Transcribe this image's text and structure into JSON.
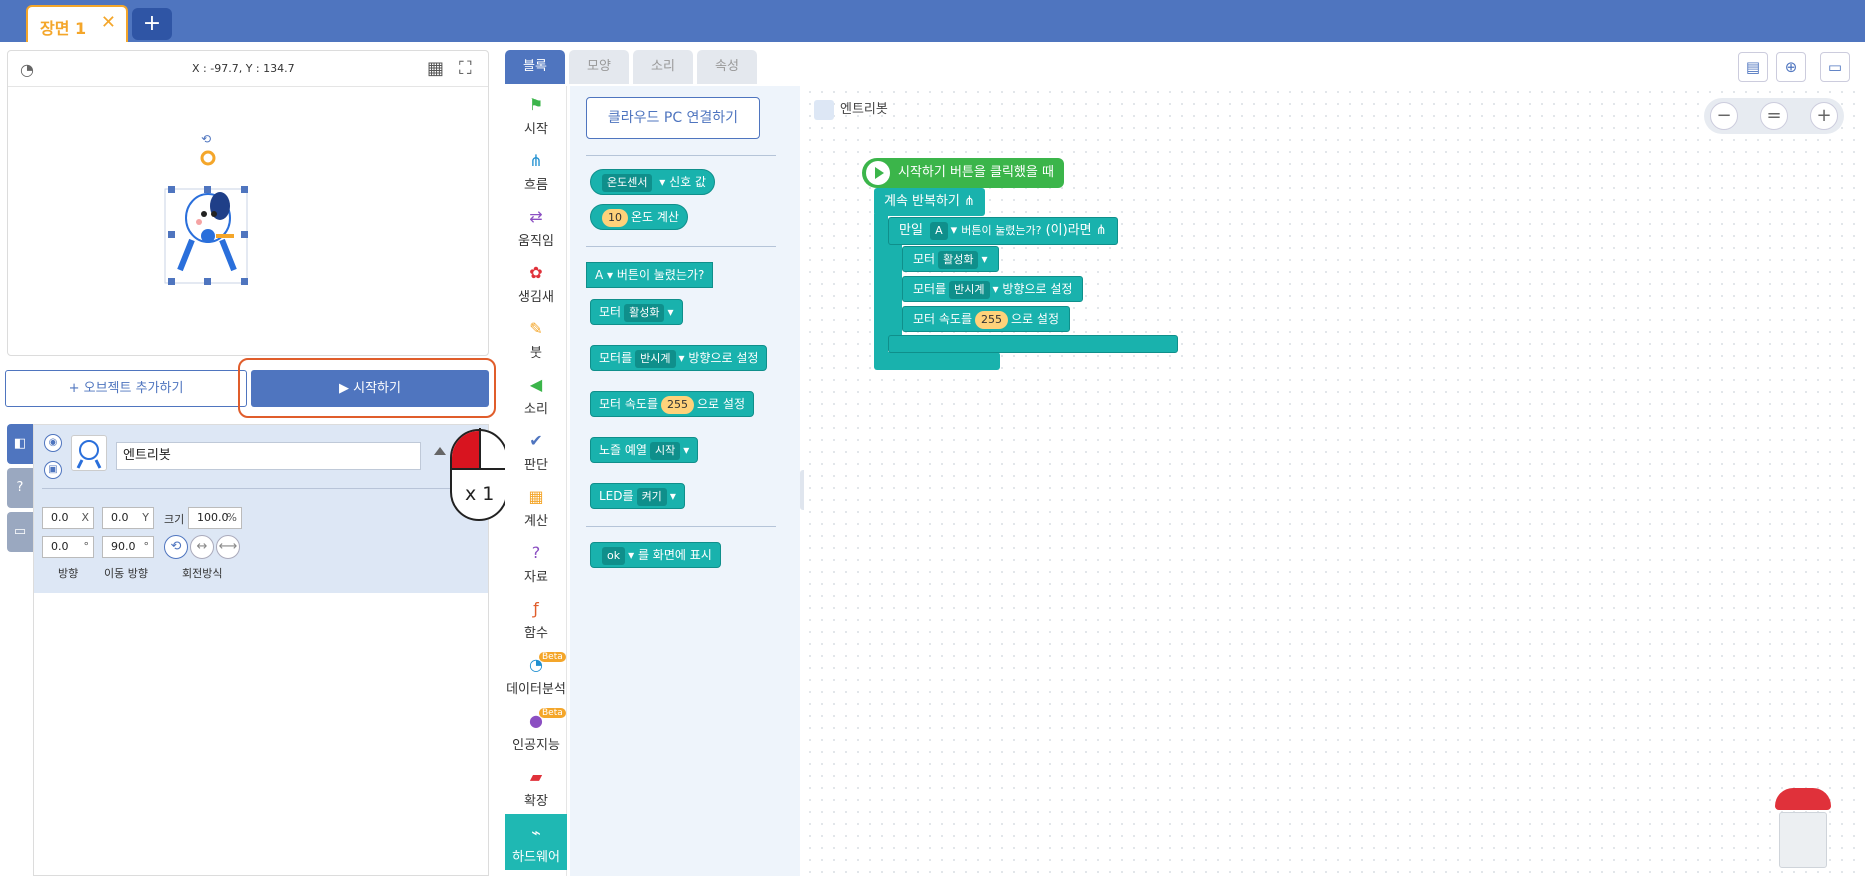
{
  "scene": {
    "tab_label": "장면 1",
    "close_symbol": "✕",
    "add_symbol": "+"
  },
  "stage": {
    "coords": "X : -97.7, Y : 134.7"
  },
  "buttons": {
    "add_object": "+ 오브젝트 추가하기",
    "start": "▶ 시작하기"
  },
  "object": {
    "name": "엔트리봇",
    "x_value": "0.0",
    "x_unit": "X",
    "y_value": "0.0",
    "y_unit": "Y",
    "size_label": "크기",
    "size_value": "100.0",
    "size_unit": "%",
    "direction_value": "0.0",
    "move_direction_value": "90.0",
    "degree_unit": "°",
    "direction_label": "방향",
    "move_direction_label": "이동 방향",
    "rotation_label": "회전방식"
  },
  "mouse_hint": {
    "count": "x 1"
  },
  "block_tabs": [
    "블록",
    "모양",
    "소리",
    "속성"
  ],
  "categories": [
    {
      "label": "시작",
      "icon": "flag-icon"
    },
    {
      "label": "흐름",
      "icon": "flow-icon"
    },
    {
      "label": "움직임",
      "icon": "move-icon"
    },
    {
      "label": "생김새",
      "icon": "looks-icon"
    },
    {
      "label": "붓",
      "icon": "brush-icon"
    },
    {
      "label": "소리",
      "icon": "sound-icon"
    },
    {
      "label": "판단",
      "icon": "check-icon"
    },
    {
      "label": "계산",
      "icon": "calc-icon"
    },
    {
      "label": "자료",
      "icon": "data-icon"
    },
    {
      "label": "함수",
      "icon": "function-icon"
    },
    {
      "label": "데이터분석",
      "icon": "chart-icon",
      "badge": "Beta"
    },
    {
      "label": "인공지능",
      "icon": "ai-icon",
      "badge": "Beta"
    },
    {
      "label": "확장",
      "icon": "extension-icon"
    },
    {
      "label": "하드웨어",
      "icon": "hardware-icon"
    }
  ],
  "palette": {
    "cloud_button": "클라우드 PC 연결하기",
    "temp_sensor": "온도센서",
    "signal_value": "신호 값",
    "temp_num": "10",
    "temp_calc": "온도 계산",
    "btn_a": "A",
    "btn_pressed": "버튼이 눌렸는가?",
    "motor": "모터",
    "activate": "활성화",
    "motor_dir_pre": "모터를",
    "counter_clockwise": "반시계",
    "motor_dir_post": "방향으로 설정",
    "motor_speed_pre": "모터 속도를",
    "speed": "255",
    "speed_post": "으로 설정",
    "note": "노즐 예열",
    "start": "시작",
    "led": "LED를",
    "on": "켜기",
    "ok": "ok",
    "display": "를 화면에 표시"
  },
  "script": {
    "object_name": "엔트리봇",
    "trigger": "시작하기 버튼을 클릭했을 때",
    "loop": "계속 반복하기",
    "if": "만일",
    "if_suffix": "(이)라면",
    "btn_a": "A",
    "btn_pressed": "버튼이 눌렸는가?",
    "motor": "모터",
    "activate": "활성화",
    "motor_dir_pre": "모터를",
    "counter_clockwise": "반시계",
    "motor_dir_post": "방향으로 설정",
    "motor_speed_pre": "모터 속도를",
    "speed": "255",
    "speed_post": "으로 설정"
  },
  "zoom": {
    "minus": "−",
    "reset": "=",
    "plus": "+"
  },
  "colors": {
    "brand": "#4f75bf",
    "block": "#19b2ad",
    "trigger": "#3bb54a",
    "highlight": "#e05d2b",
    "tab_accent": "#f4a62a"
  }
}
